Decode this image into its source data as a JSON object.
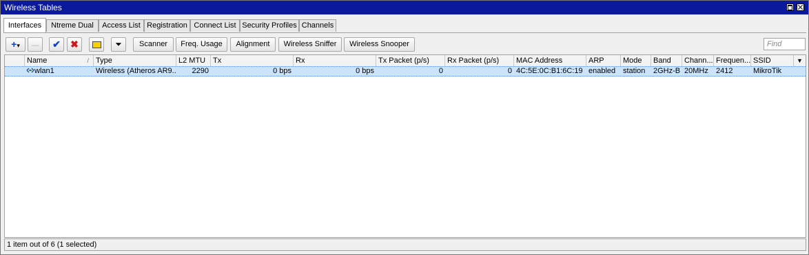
{
  "window": {
    "title": "Wireless Tables"
  },
  "tabs": [
    {
      "label": "Interfaces",
      "active": true
    },
    {
      "label": "Ntreme Dual"
    },
    {
      "label": "Access List"
    },
    {
      "label": "Registration"
    },
    {
      "label": "Connect List"
    },
    {
      "label": "Security Profiles"
    },
    {
      "label": "Channels"
    }
  ],
  "toolbar": {
    "add_glyph": "+",
    "add_dropdown_glyph": "▾",
    "remove_glyph": "—",
    "enable_glyph": "✔",
    "disable_glyph": "✖",
    "comment_icon": "comment-icon",
    "filter_glyph": "⏷",
    "buttons": [
      "Scanner",
      "Freq. Usage",
      "Alignment",
      "Wireless Sniffer",
      "Wireless Snooper"
    ],
    "find_placeholder": "Find"
  },
  "table": {
    "columns": [
      "Name",
      "Type",
      "L2 MTU",
      "Tx",
      "Rx",
      "Tx Packet (p/s)",
      "Rx Packet (p/s)",
      "MAC Address",
      "ARP",
      "Mode",
      "Band",
      "Chann...",
      "Frequen...",
      "SSID"
    ],
    "sort_glyph": "/",
    "dropdown_glyph": "▼",
    "rows": [
      {
        "icon": "wireless-interface-icon",
        "selected": true,
        "cells": [
          "wlan1",
          "Wireless (Atheros AR9...",
          "2290",
          "0 bps",
          "0 bps",
          "0",
          "0",
          "4C:5E:0C:B1:6C:19",
          "enabled",
          "station",
          "2GHz-B",
          "20MHz",
          "2412",
          "MikroTik"
        ]
      }
    ]
  },
  "status": {
    "text": "1 item out of 6 (1 selected)"
  },
  "colors": {
    "titlebar": "#0b1a9c",
    "selection": "#cce4fb",
    "add_blue": "#1540c8",
    "disable_red": "#d01818",
    "enable_blue": "#1540c8",
    "comment_yellow": "#f5d200"
  }
}
